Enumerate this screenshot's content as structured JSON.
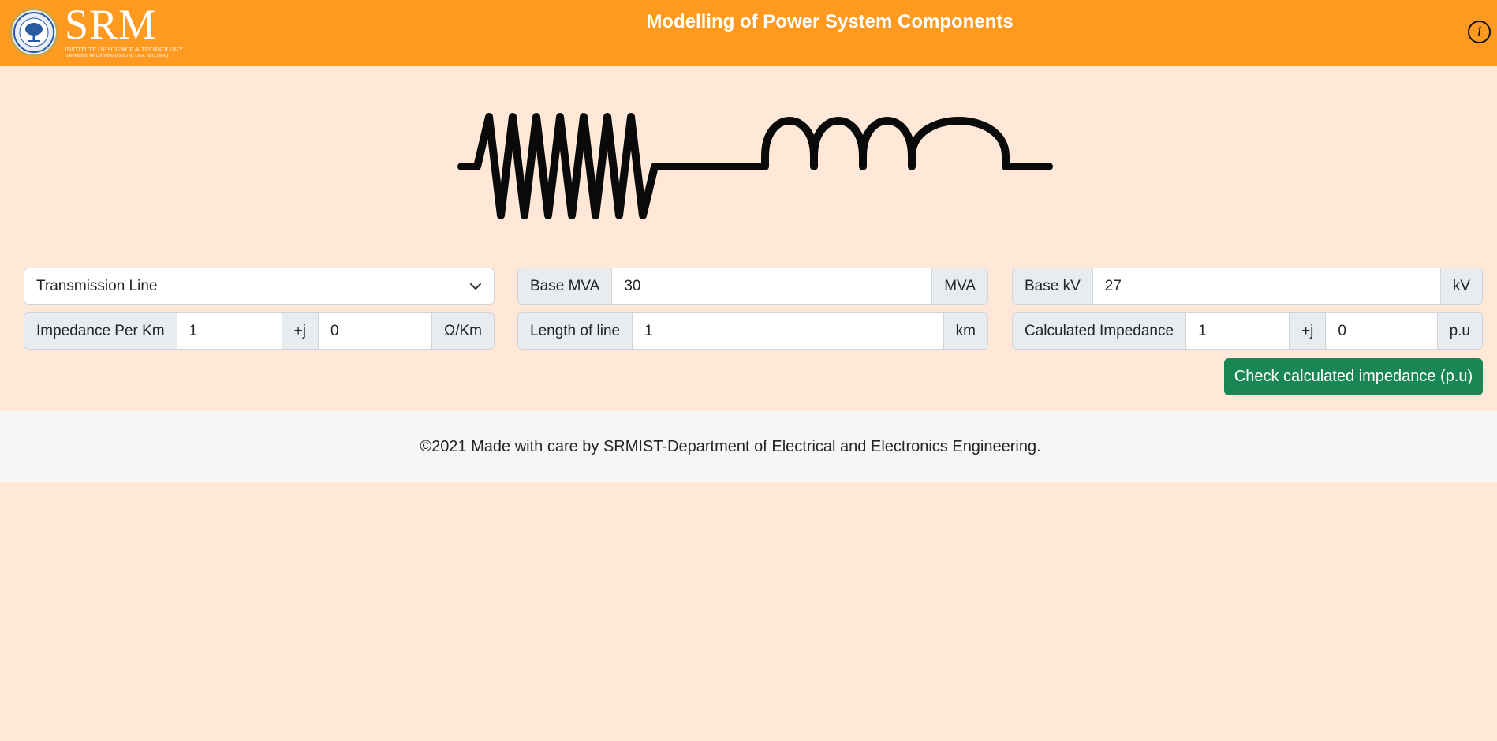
{
  "header": {
    "logo": {
      "name": "SRM",
      "subtitle": "INSTITUTE OF SCIENCE & TECHNOLOGY",
      "tagline": "(Deemed to be University u/s 3 of UGC Act, 1956)"
    },
    "title": "Modelling of Power System Components",
    "info_icon": "info-icon",
    "info_glyph": "i"
  },
  "component_select": {
    "selected": "Transmission Line",
    "icon": "chevron-down-icon"
  },
  "base_mva": {
    "label": "Base MVA",
    "value": "30",
    "unit": "MVA"
  },
  "base_kv": {
    "label": "Base kV",
    "value": "27",
    "unit": "kV"
  },
  "impedance_per_km": {
    "label": "Impedance Per Km",
    "real": "1",
    "j_label": "+j",
    "imag": "0",
    "unit": "Ω/Km"
  },
  "length_of_line": {
    "label": "Length of line",
    "value": "1",
    "unit": "km"
  },
  "calculated_impedance": {
    "label": "Calculated Impedance",
    "real": "1",
    "j_label": "+j",
    "imag": "0",
    "unit": "p.u"
  },
  "check_button": {
    "label": "Check calculated impedance (p.u)"
  },
  "footer": {
    "text": "©2021 Made with care by SRMIST-Department of Electrical and Electronics Engineering."
  },
  "colors": {
    "header": "#ff9a20",
    "background": "#ffe8d8",
    "button": "#198754",
    "footer": "#f8f6f5"
  }
}
